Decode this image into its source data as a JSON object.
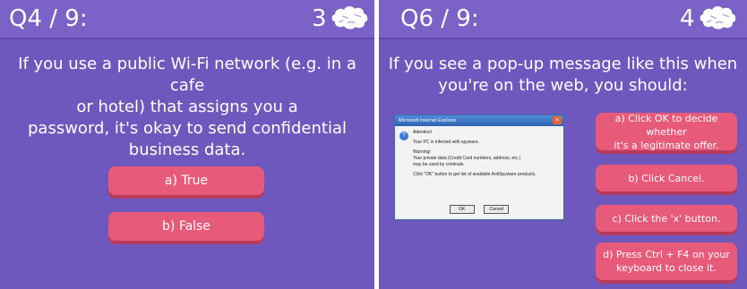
{
  "left": {
    "question_number": "Q4 / 9:",
    "score": "3",
    "question_lines": [
      "If you use a public Wi-Fi network (e.g. in a cafe",
      "or hotel) that assigns you a",
      "password, it's okay to send confidential",
      "business data."
    ],
    "answers": [
      "a) True",
      "b) False"
    ]
  },
  "right": {
    "question_number": "Q6 / 9:",
    "score": "4",
    "question_lines": [
      "If you see a pop-up message like this when",
      "you're on the web, you should:"
    ],
    "answers": [
      [
        "a) Click OK to decide whether",
        "it's a legitimate offer."
      ],
      [
        "b) Click Cancel."
      ],
      [
        "c) Click the 'x' button."
      ],
      [
        "d) Press Ctrl + F4 on your",
        "keyboard to close it."
      ]
    ],
    "dialog": {
      "title": "Microsoft Internet Explorer",
      "close_glyph": "×",
      "icon_glyph": "?",
      "lines": [
        "Attention!",
        "",
        "Your PC is infected with spyware.",
        "",
        "Warning!",
        "Your private data (Credit Card numbers, address, etc.)",
        "may be used by criminals.",
        "",
        "Click \"OK\" button to get list of available AntiSpyware products."
      ],
      "ok_label": "OK",
      "cancel_label": "Cancel"
    }
  },
  "colors": {
    "panel_bg": "#6f58bd",
    "answer_bg": "#e85a7a",
    "text": "#ffffff"
  },
  "icons": {
    "score_icon": "brain-icon"
  }
}
